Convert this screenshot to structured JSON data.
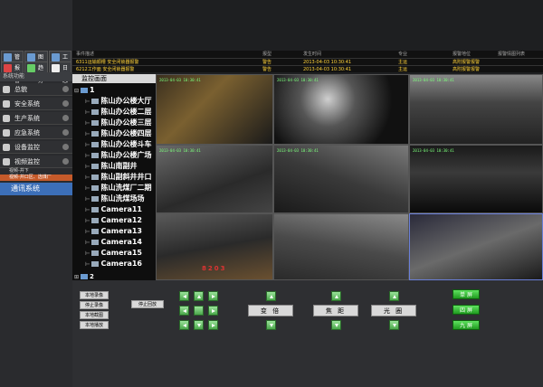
{
  "toolbar": {
    "row1": [
      {
        "label": "管理",
        "icon": "gear-icon"
      },
      {
        "label": "图表",
        "icon": "chart-icon"
      },
      {
        "label": "工具",
        "icon": "tools-icon"
      }
    ],
    "row2": [
      {
        "label": "报警",
        "icon": "alarm-icon"
      },
      {
        "label": "趋势",
        "icon": "trend-icon"
      },
      {
        "label": "日志",
        "icon": "log-icon"
      }
    ]
  },
  "sidebar": {
    "header": "系统功能",
    "items": [
      {
        "label": "总貌",
        "icon": "overview-icon"
      },
      {
        "label": "安全系统",
        "icon": "safety-icon"
      },
      {
        "label": "生产系统",
        "icon": "production-icon"
      },
      {
        "label": "应急系统",
        "icon": "emergency-icon"
      },
      {
        "label": "设备监控",
        "icon": "device-icon"
      },
      {
        "label": "视频监控",
        "icon": "camera-icon"
      }
    ],
    "subitems": [
      "视频-井下",
      "视频-井口区、选煤厂"
    ],
    "active": "通讯系统"
  },
  "alarm_table": {
    "headers": [
      "事件描述",
      "报型",
      "发生时间",
      "专业",
      "报警地位"
    ],
    "rows": [
      [
        "6311运输顺槽 安全闭锁器报警",
        "警告",
        "2013-04-03 10:30:41",
        "主运",
        "高附报警报警"
      ],
      [
        "6212工作面 安全闭锁器报警",
        "警告",
        "2013-04-03 10:30:41",
        "主运",
        "高附报警报警"
      ]
    ],
    "aux": "报警情图列表"
  },
  "tree": {
    "header": "监控画面",
    "root": "1",
    "nodes": [
      "陈山办公楼大厅",
      "陈山办公楼二层",
      "陈山办公楼三层",
      "陈山办公楼四层",
      "陈山办公楼斗车",
      "陈山办公楼广场",
      "陈山南副井",
      "陈山副斜井井口",
      "陈山洗煤厂二期",
      "陈山洗煤场场",
      "Camera11",
      "Camera12",
      "Camera13",
      "Camera14",
      "Camera15",
      "Camera16"
    ],
    "root2": "2"
  },
  "videos": [
    {
      "stamp": ""
    },
    {
      "stamp": ""
    },
    {
      "stamp": ""
    },
    {
      "stamp": "2013-04-03 10:30:41"
    },
    {
      "stamp": "2013-04-03 10:30:41"
    },
    {
      "stamp": "2013-04-03 10:30:41"
    },
    {
      "stamp": "2013-04-03 10:30:41"
    },
    {
      "stamp": "2013-04-03 10:30:41"
    },
    {
      "stamp": "2013-04-03 10:30:41"
    },
    {
      "stamp": ""
    },
    {
      "stamp": ""
    },
    {
      "stamp": ""
    }
  ],
  "video_text": "8203",
  "controls": {
    "left_buttons": [
      "本地录像",
      "停止录像",
      "本地截图",
      "本地播放"
    ],
    "playback": "停止回放",
    "zoom": "变 倍",
    "focus": "焦 距",
    "iris": "光 圈",
    "layouts": [
      "单 屏",
      "四 屏",
      "九 屏"
    ]
  }
}
